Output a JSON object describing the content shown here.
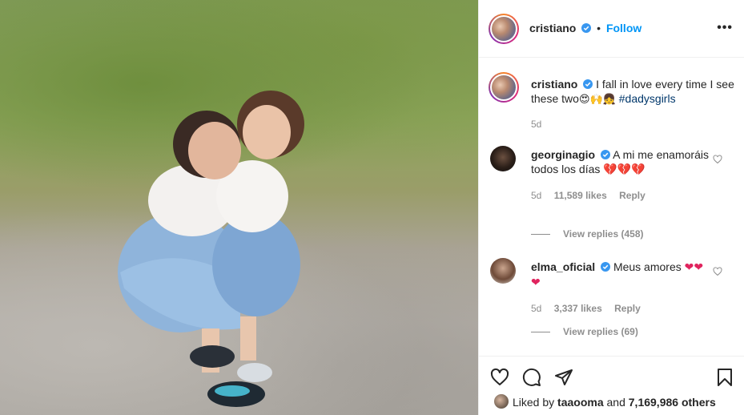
{
  "post": {
    "username": "cristiano",
    "follow_label": "Follow",
    "dot": "•",
    "more_label": "•••"
  },
  "caption": {
    "username": "cristiano",
    "text": "I fall in love every time I see these two",
    "emojis": "😍🙌👧",
    "hashtag": "#dadysgirls",
    "time": "5d"
  },
  "comments": [
    {
      "username": "georginagio",
      "text": "A mi me enamoráis todos los días",
      "hearts": "💔💔💔",
      "time": "5d",
      "likes": "11,589 likes",
      "reply": "Reply",
      "view_replies": "View replies (458)"
    },
    {
      "username": "elma_oficial",
      "text": "Meus amores",
      "hearts": "❤❤❤",
      "time": "5d",
      "likes": "3,337 likes",
      "reply": "Reply",
      "view_replies": "View replies (69)"
    }
  ],
  "likes_bar": {
    "prefix": "Liked by",
    "liker": "taaooma",
    "and": "and",
    "count": "7,169,986 others"
  },
  "icons": {
    "like": "heart-outline-icon",
    "comment": "comment-icon",
    "share": "paper-plane-icon",
    "save": "bookmark-icon",
    "verified": "verified-badge-icon"
  },
  "colors": {
    "accent": "#0095f6",
    "verified": "#3897f0",
    "muted": "#8e8e8e",
    "hashtag": "#00376b",
    "heart": "#e0245e"
  }
}
